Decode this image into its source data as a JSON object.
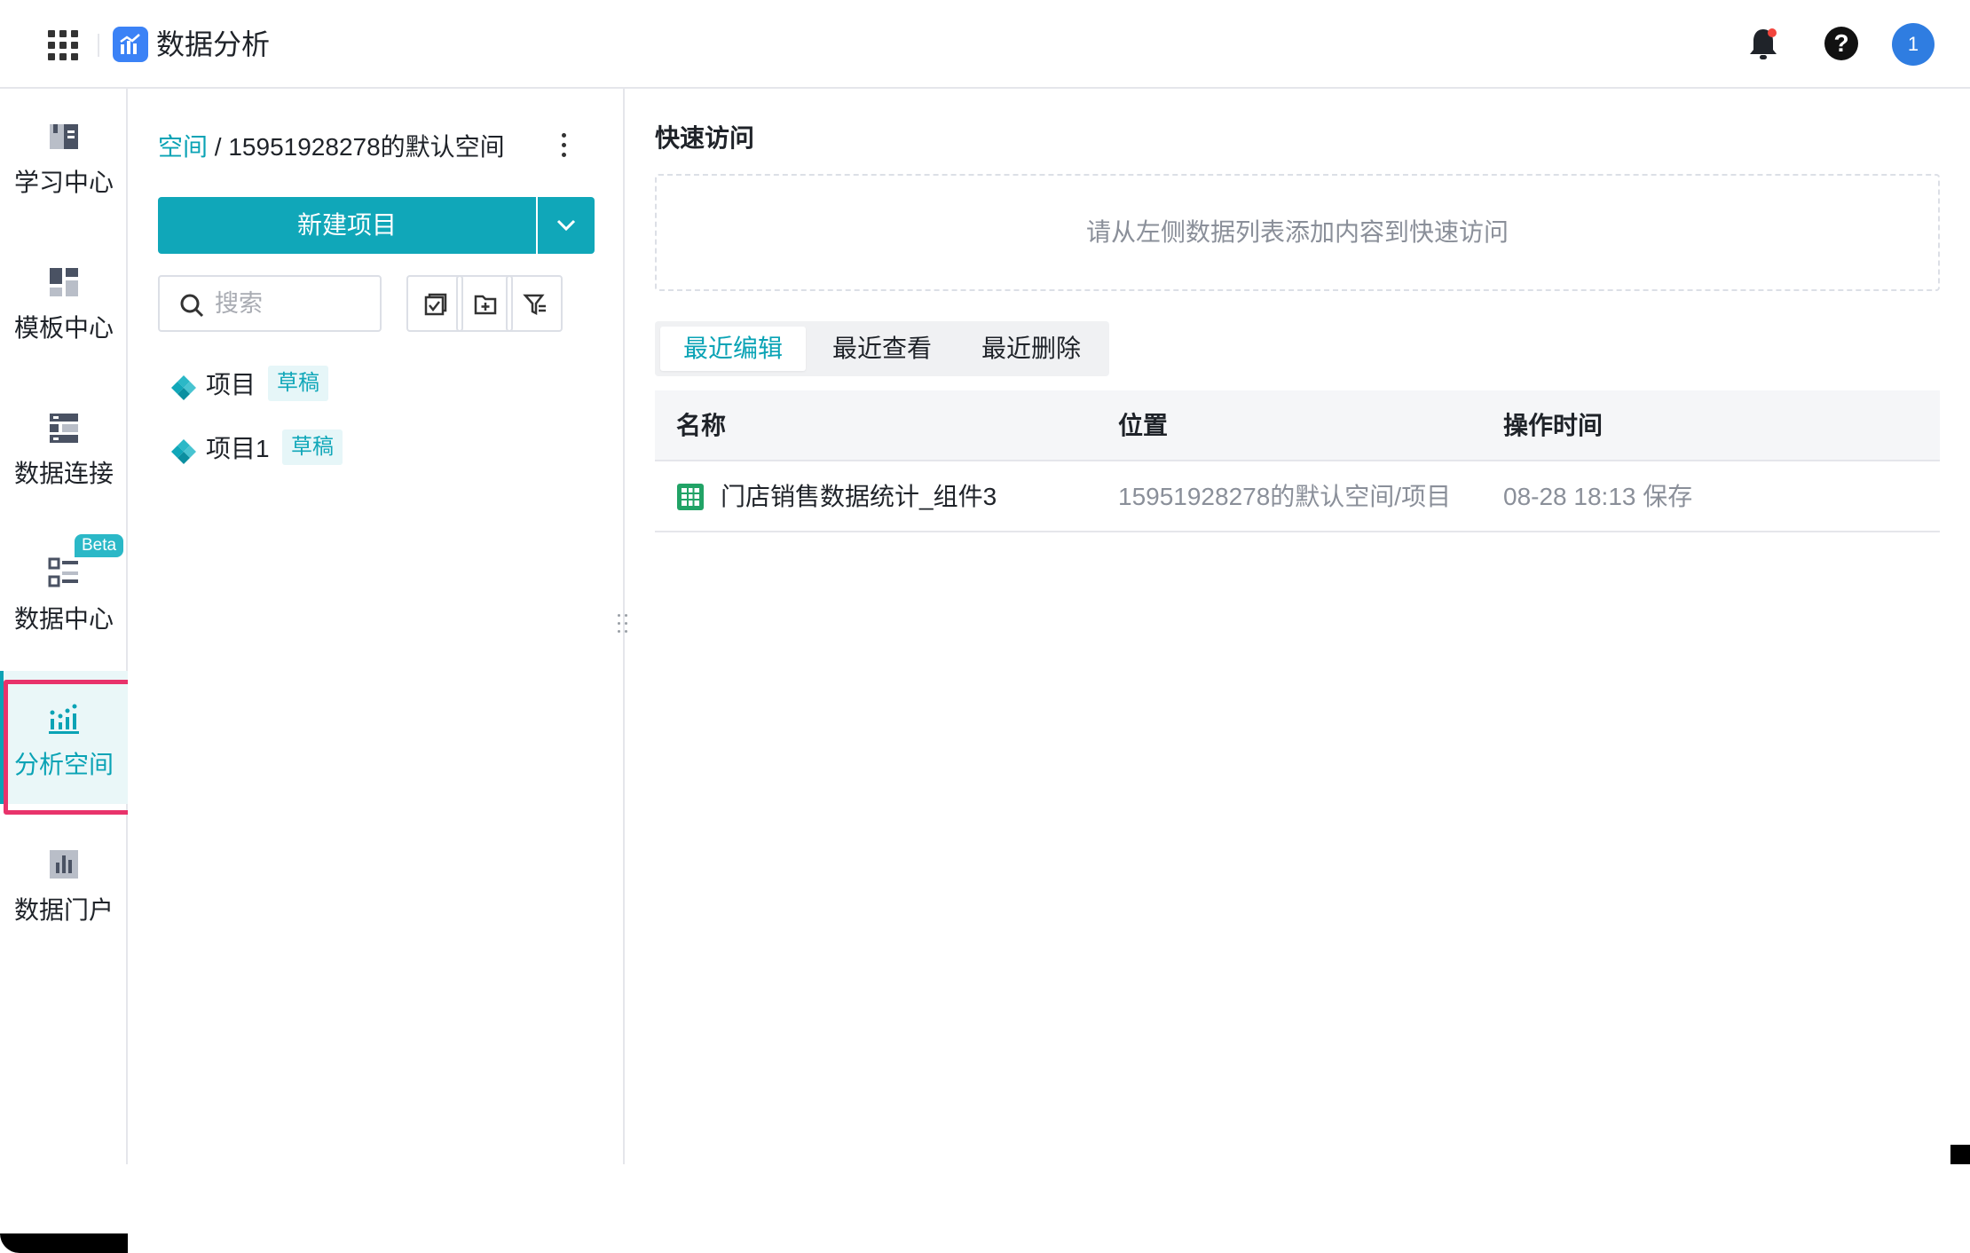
{
  "header": {
    "app_title": "数据分析",
    "avatar_text": "1",
    "help_text": "?",
    "icons": [
      "apps-grid-icon",
      "logo-icon",
      "bell-icon",
      "help-icon"
    ]
  },
  "nav": {
    "items": [
      {
        "label": "学习中心",
        "icon": "book-icon"
      },
      {
        "label": "模板中心",
        "icon": "template-icon"
      },
      {
        "label": "数据连接",
        "icon": "connection-icon"
      },
      {
        "label": "数据中心",
        "icon": "data-center-icon",
        "badge": "Beta"
      },
      {
        "label": "分析空间",
        "icon": "analysis-icon",
        "active": true
      },
      {
        "label": "数据门户",
        "icon": "portal-icon"
      }
    ]
  },
  "panel": {
    "breadcrumb_root": "空间",
    "breadcrumb_sep": " / ",
    "breadcrumb_current": "15951928278的默认空间",
    "new_project_label": "新建项目",
    "search_placeholder": "搜索",
    "tree": [
      {
        "name": "项目",
        "tag": "草稿"
      },
      {
        "name": "项目1",
        "tag": "草稿"
      }
    ]
  },
  "main": {
    "quick_access_title": "快速访问",
    "quick_access_hint": "请从左侧数据列表添加内容到快速访问",
    "tabs": [
      {
        "label": "最近编辑",
        "active": true
      },
      {
        "label": "最近查看",
        "active": false
      },
      {
        "label": "最近删除",
        "active": false
      }
    ],
    "table": {
      "columns": [
        "名称",
        "位置",
        "操作时间"
      ],
      "rows": [
        {
          "name": "门店销售数据统计_组件3",
          "location": "15951928278的默认空间/项目",
          "time": "08-28 18:13 保存"
        }
      ]
    }
  },
  "colors": {
    "accent": "#0aa3b5",
    "primary_button": "#10a7b9",
    "highlight_border": "#e8336b",
    "avatar": "#2f7de1"
  }
}
